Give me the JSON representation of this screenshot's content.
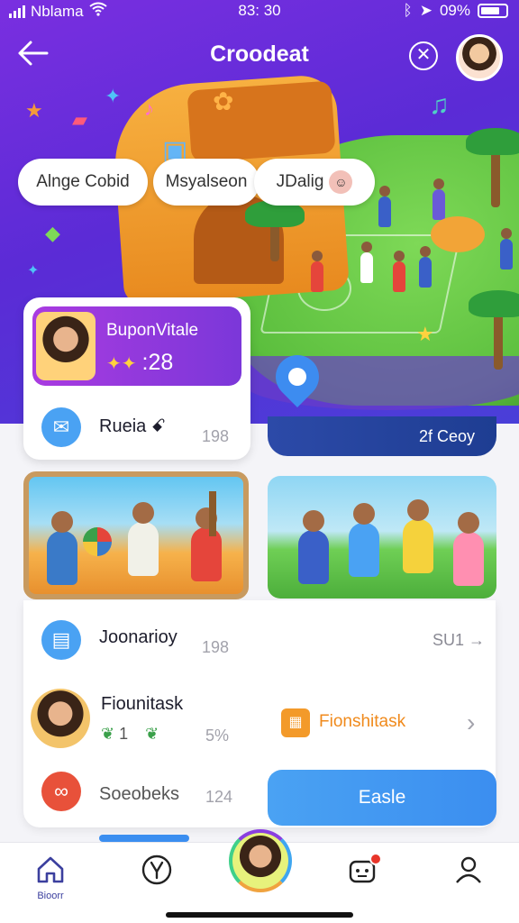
{
  "status_bar": {
    "carrier": "Nblama",
    "time": "83: 30",
    "battery": "09%"
  },
  "nav": {
    "title": "Croodeat"
  },
  "chips": [
    {
      "label": "Alnge Cobid"
    },
    {
      "label": "Msyalseon"
    },
    {
      "label": "JDalig"
    }
  ],
  "profile_card": {
    "name": "BuponVitale",
    "stat": ":28",
    "row_label": "Rueia ꗃ",
    "row_count": "198"
  },
  "hero_pill": {
    "label": "2f Ceoy"
  },
  "activity_card": {
    "label": "Joonarioy",
    "count": "198",
    "link": "SU1"
  },
  "task_row": {
    "title": "Fiounitask",
    "stat": "1",
    "percent": "5%"
  },
  "sessions_row": {
    "label": "Soeobeks",
    "count": "124"
  },
  "orange_link": {
    "label": "Fionshitask"
  },
  "cta_button": {
    "label": "Easle"
  },
  "tabbar": {
    "home_label": "Bioorr"
  },
  "colors": {
    "primary": "#7a2fe0",
    "accent_blue": "#3b8ef0",
    "accent_orange": "#f08a1c"
  },
  "icons": [
    "back-arrow-icon",
    "close-icon",
    "mail-icon",
    "chat-icon",
    "home-icon",
    "tools-icon",
    "robot-icon",
    "profile-icon"
  ]
}
